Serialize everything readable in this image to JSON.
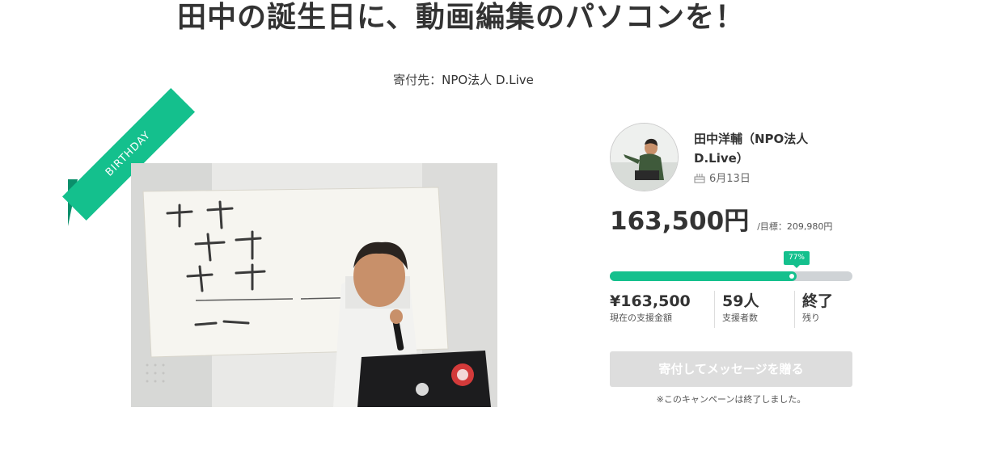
{
  "campaign": {
    "title": "田中の誕生日に、動画編集のパソコンを！",
    "beneficiary_prefix": "寄付先：",
    "beneficiary_name": "NPO法人 D.Live",
    "ribbon_label": "BIRTHDAY"
  },
  "owner": {
    "name": "田中洋輔（NPO法人 D.Live）",
    "birthday": "6月13日"
  },
  "funding": {
    "raised": "163,500円",
    "goal_label": "/目標：209,980円",
    "percent_label": "77%",
    "percent": 77
  },
  "stats": [
    {
      "value": "¥163,500",
      "label": "現在の支援金額"
    },
    {
      "value": "59人",
      "label": "支援者数"
    },
    {
      "value": "終了",
      "label": "残り"
    }
  ],
  "action": {
    "button_label": "寄付してメッセージを贈る",
    "ended_note": "※このキャンペーンは終了しました。"
  },
  "colors": {
    "accent": "#14c08d",
    "text": "#333333",
    "track": "#cfd3d6",
    "button_disabled": "#dddddd"
  }
}
